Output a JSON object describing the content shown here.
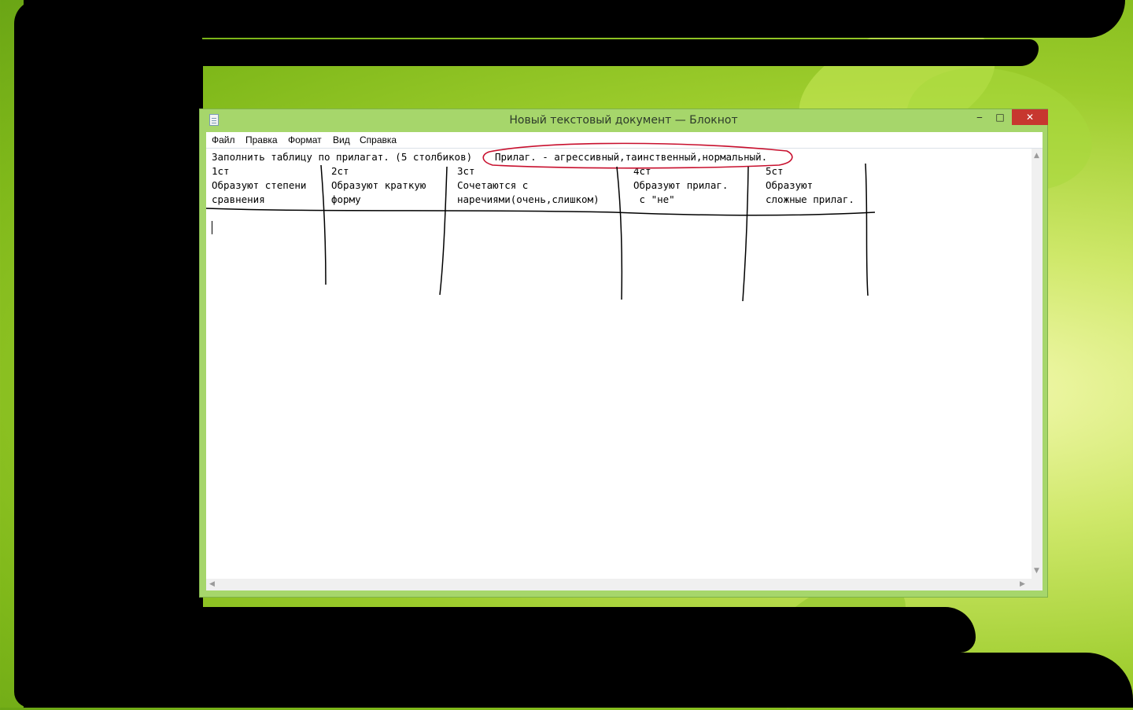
{
  "window": {
    "title": "Новый текстовый документ — Блокнот",
    "controls": {
      "minimize": "‒",
      "maximize": "□",
      "close": "✕"
    }
  },
  "menu": [
    "Файл",
    "Правка",
    "Формат",
    "Вид",
    "Справка"
  ],
  "document": {
    "line1_a": "Заполнить таблицу по прилагат. (5 столбиков)",
    "line1_b": "Прилаг. - агрессивный,таинственный,нормальный.",
    "columns": [
      {
        "header": "1ст",
        "line1": "Образуют степени",
        "line2": "сравнения"
      },
      {
        "header": "2ст",
        "line1": "Образуют краткую",
        "line2": "форму"
      },
      {
        "header": "3ст",
        "line1": "Сочетаются с",
        "line2": "наречиями(очень,слишком)"
      },
      {
        "header": "4ст",
        "line1": "Образуют прилаг.",
        "line2": " с \"не\""
      },
      {
        "header": "5ст",
        "line1": "Образуют",
        "line2": "сложные прилаг."
      }
    ]
  },
  "colors": {
    "window_frame": "#a6d66b",
    "close_button": "#c7372f",
    "annotation_red": "#c8102e"
  }
}
